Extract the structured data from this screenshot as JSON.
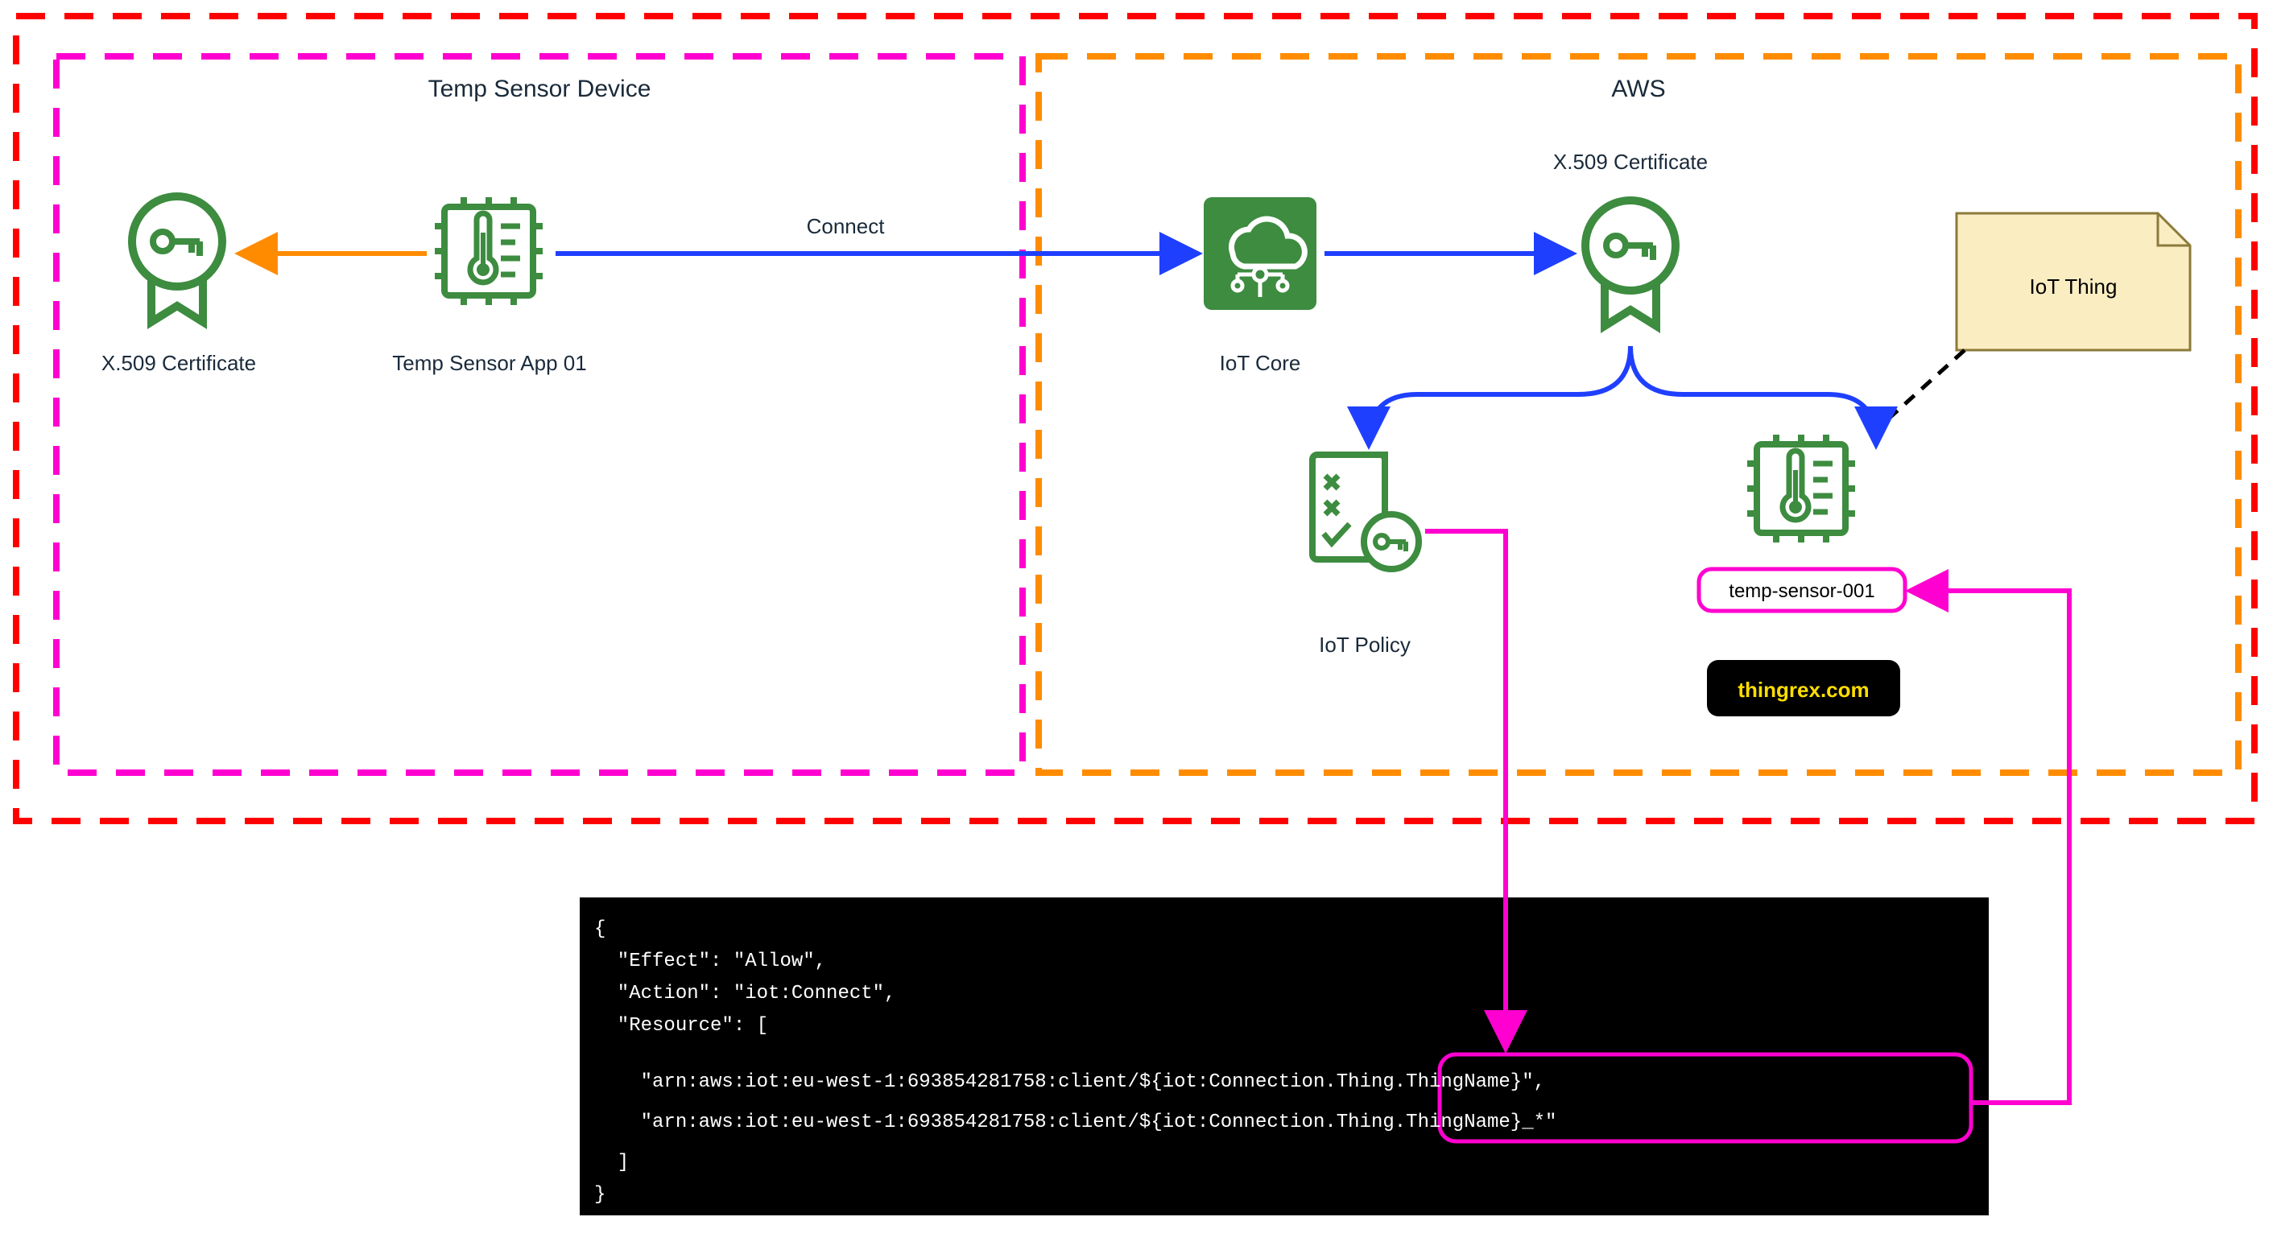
{
  "device": {
    "title": "Temp Sensor Device",
    "cert_label": "X.509 Certificate",
    "app_label": "Temp Sensor App 01"
  },
  "aws": {
    "title": "AWS",
    "iot_core_label": "IoT Core",
    "cert_label": "X.509 Certificate",
    "iot_policy_label": "IoT Policy",
    "thing_name": "temp-sensor-001",
    "note_label": "IoT Thing",
    "watermark": "thingrex.com"
  },
  "arrows": {
    "connect_label": "Connect"
  },
  "code": {
    "l1": "{",
    "l2": "  \"Effect\": \"Allow\",",
    "l3": "  \"Action\": \"iot:Connect\",",
    "l4": "  \"Resource\": [",
    "l5a": "    \"arn:aws:iot:eu-west-1:693854281758:client/",
    "l5b": "${iot:Connection.Thing.ThingName}\",",
    "l6a": "    \"arn:aws:iot:eu-west-1:693854281758:client/",
    "l6b": "${iot:Connection.Thing.ThingName}_*\"",
    "l7": "  ]",
    "l8": "}"
  },
  "colors": {
    "red": "#ff0000",
    "magenta": "#ff00d0",
    "orange": "#ff8c00",
    "blue": "#1f3fff",
    "aws_green": "#3d8c40",
    "green_stroke": "#3d8c40",
    "code_bg": "#000000",
    "note_fill": "#faedc2",
    "note_stroke": "#8b7a3a"
  }
}
